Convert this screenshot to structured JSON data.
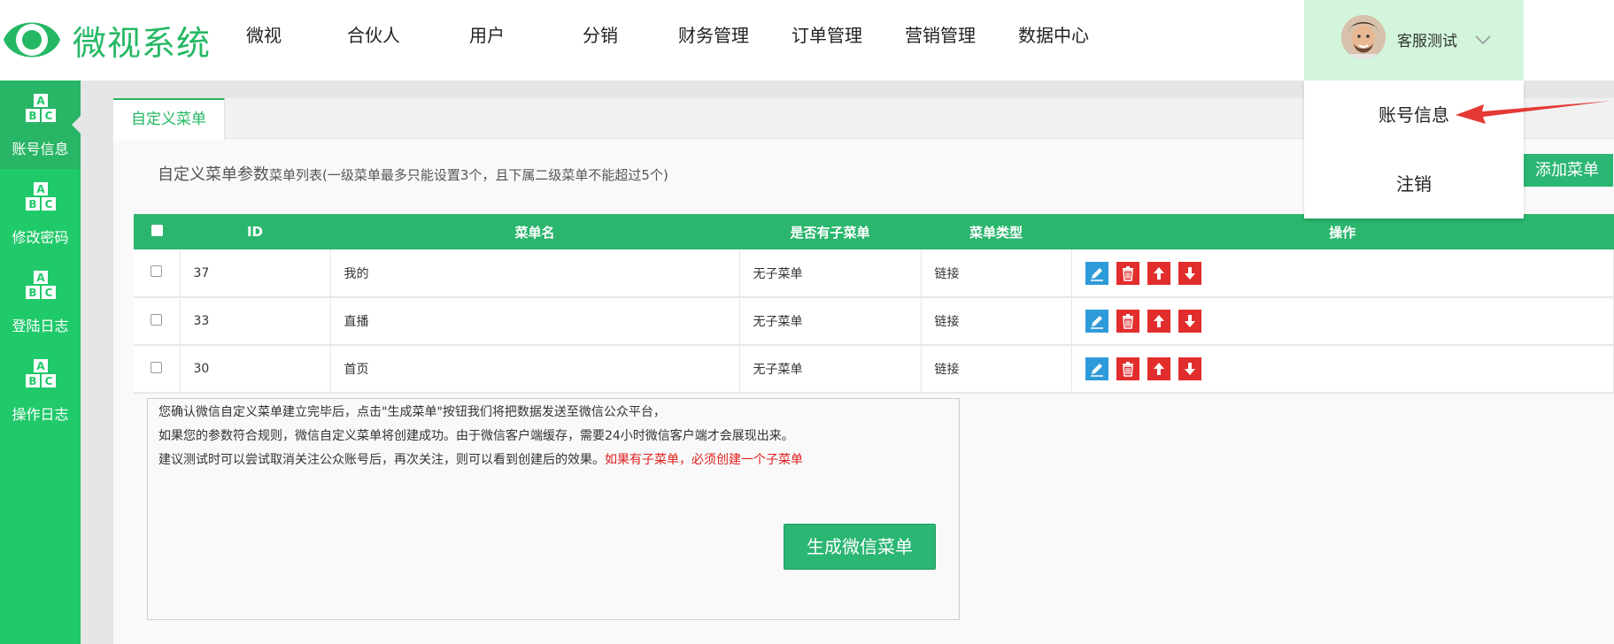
{
  "header": {
    "logo_text": "微视系统",
    "nav": [
      "微视",
      "合伙人",
      "用户",
      "分销",
      "财务管理",
      "订单管理",
      "营销管理",
      "数据中心"
    ],
    "user_name": "客服测试",
    "dropdown": [
      "账号信息",
      "注销"
    ]
  },
  "sidebar": {
    "items": [
      {
        "label": "账号信息",
        "icon": "abc-blocks-icon"
      },
      {
        "label": "修改密码",
        "icon": "abc-blocks-icon"
      },
      {
        "label": "登陆日志",
        "icon": "abc-blocks-icon"
      },
      {
        "label": "操作日志",
        "icon": "abc-blocks-icon"
      }
    ]
  },
  "main": {
    "tab": "自定义菜单",
    "section_title": "自定义菜单参数",
    "section_sub": "菜单列表(一级菜单最多只能设置3个，且下属二级菜单不能超过5个)",
    "add_button": "添加菜单",
    "table": {
      "headers": [
        "ID",
        "菜单名",
        "是否有子菜单",
        "菜单类型",
        "操作"
      ],
      "rows": [
        {
          "id": "37",
          "name": "我的",
          "has_sub": "无子菜单",
          "type": "链接"
        },
        {
          "id": "33",
          "name": "直播",
          "has_sub": "无子菜单",
          "type": "链接"
        },
        {
          "id": "30",
          "name": "首页",
          "has_sub": "无子菜单",
          "type": "链接"
        }
      ]
    },
    "notice": {
      "line1": "您确认微信自定义菜单建立完毕后，点击\"生成菜单\"按钮我们将把数据发送至微信公众平台，",
      "line2": "如果您的参数符合规则，微信自定义菜单将创建成功。由于微信客户端缓存，需要24小时微信客户端才会展现出来。",
      "line3": "建议测试时可以尝试取消关注公众账号后，再次关注，则可以看到创建后的效果。",
      "warning": "如果有子菜单，必须创建一个子菜单"
    },
    "generate_button": "生成微信菜单"
  },
  "colors": {
    "brand_green": "#25b864",
    "sidebar_green": "#20c96a",
    "danger_red": "#e22d2d",
    "edit_blue": "#2e9bd9"
  }
}
